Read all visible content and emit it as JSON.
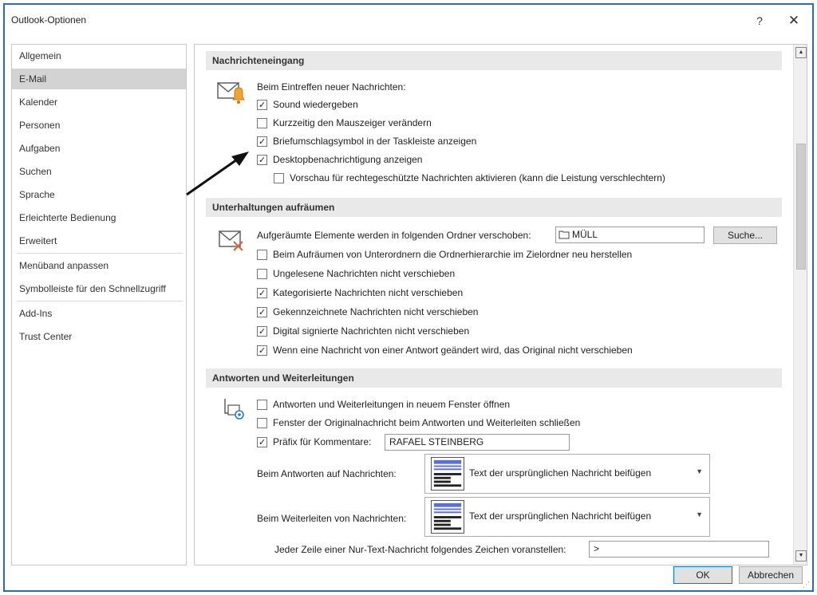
{
  "window": {
    "title": "Outlook-Optionen",
    "help": "?",
    "close": "✕"
  },
  "nav": {
    "items": [
      "Allgemein",
      "E-Mail",
      "Kalender",
      "Personen",
      "Aufgaben",
      "Suchen",
      "Sprache",
      "Erleichterte Bedienung",
      "Erweitert",
      "Menüband anpassen",
      "Symbolleiste für den Schnellzugriff",
      "Add-Ins",
      "Trust Center"
    ],
    "selected": "E-Mail"
  },
  "sections": {
    "nachrichteneingang": {
      "title": "Nachrichteneingang",
      "intro": "Beim Eintreffen neuer Nachrichten:",
      "options": [
        {
          "label": "Sound wiedergeben",
          "checked": true
        },
        {
          "label": "Kurzzeitig den Mauszeiger verändern",
          "checked": false
        },
        {
          "label": "Briefumschlagsymbol in der Taskleiste anzeigen",
          "checked": true
        },
        {
          "label": "Desktopbenachrichtigung anzeigen",
          "checked": true
        },
        {
          "label": "Vorschau für rechtegeschützte Nachrichten aktivieren (kann die Leistung verschlechtern)",
          "checked": false
        }
      ]
    },
    "unterhaltungen": {
      "title": "Unterhaltungen aufräumen",
      "folder_label": "Aufgeräumte Elemente werden in folgenden Ordner verschoben:",
      "folder_value": "MÜLL",
      "browse_button": "Suche...",
      "options": [
        {
          "label": "Beim Aufräumen von Unterordnern die Ordnerhierarchie im Zielordner neu herstellen",
          "checked": false
        },
        {
          "label": "Ungelesene Nachrichten nicht verschieben",
          "checked": false
        },
        {
          "label": "Kategorisierte Nachrichten nicht verschieben",
          "checked": true
        },
        {
          "label": "Gekennzeichnete Nachrichten nicht verschieben",
          "checked": true
        },
        {
          "label": "Digital signierte Nachrichten nicht verschieben",
          "checked": true
        },
        {
          "label": "Wenn eine Nachricht von einer Antwort geändert wird, das Original nicht verschieben",
          "checked": true
        }
      ]
    },
    "antworten": {
      "title": "Antworten und Weiterleitungen",
      "options": [
        {
          "label": "Antworten und Weiterleitungen in neuem Fenster öffnen",
          "checked": false
        },
        {
          "label": "Fenster der Originalnachricht beim Antworten und Weiterleiten schließen",
          "checked": false
        },
        {
          "label": "Präfix für Kommentare:",
          "checked": true
        }
      ],
      "prefix_value": "RAFAEL STEINBERG",
      "reply_label": "Beim Antworten auf Nachrichten:",
      "reply_value": "Text der ursprünglichen Nachricht beifügen",
      "forward_label": "Beim Weiterleiten von Nachrichten:",
      "forward_value": "Text der ursprünglichen Nachricht beifügen",
      "plain_text_label": "Jeder Zeile einer Nur-Text-Nachricht folgendes Zeichen voranstellen:",
      "plain_text_value": ">"
    }
  },
  "footer": {
    "ok": "OK",
    "cancel": "Abbrechen"
  },
  "colors": {
    "accent": "#2b6cb4",
    "selected": "#d3d3d3",
    "section_header": "#e9e9e9"
  }
}
